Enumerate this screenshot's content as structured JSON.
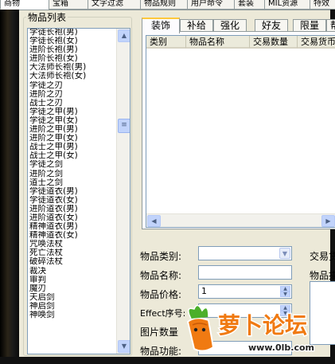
{
  "top_tabs": [
    {
      "label": "商物"
    },
    {
      "label": "宝箱"
    },
    {
      "label": "文字过滤"
    },
    {
      "label": "物品规则"
    },
    {
      "label": "用户命令"
    },
    {
      "label": "套装"
    },
    {
      "label": "MIL资源"
    },
    {
      "label": "特效"
    }
  ],
  "item_list": {
    "title": "物品列表",
    "items": [
      "学徒长袍(男)",
      "学徒长袍(女)",
      "进阶长袍(男)",
      "进阶长袍(女)",
      "大法师长袍(男)",
      "大法师长袍(女)",
      "学徒之刃",
      "进阶之刃",
      "战士之刃",
      "学徒之甲(男)",
      "学徒之甲(女)",
      "进阶之甲(男)",
      "进阶之甲(女)",
      "战士之甲(男)",
      "战士之甲(女)",
      "学徒之剑",
      "进阶之剑",
      "道士之剑",
      "学徒道衣(男)",
      "学徒道衣(女)",
      "进阶道衣(男)",
      "进阶道衣(女)",
      "精神道衣(男)",
      "精神道衣(女)",
      "咒唤法杖",
      "死亡法杖",
      "破碎法杖",
      "裁决",
      "审判",
      "魔刃",
      "天启剑",
      "神启剑",
      "神唤剑"
    ]
  },
  "right_tabs": [
    {
      "label": "装饰"
    },
    {
      "label": "补给"
    },
    {
      "label": "强化"
    },
    {
      "label": "好友"
    },
    {
      "label": "限量"
    },
    {
      "label": "帮"
    }
  ],
  "table": {
    "columns": [
      "类别",
      "物品名称",
      "交易数量",
      "交易货币"
    ]
  },
  "form": {
    "category_label": "物品类别:",
    "category_value": "",
    "name_label": "物品名称:",
    "name_value": "",
    "price_label": "物品价格:",
    "price_value": "1",
    "effect_label": "Effect序号:",
    "picture_label": "图片数量",
    "function_label": "物品功能:",
    "trade_label": "交易货",
    "item_desc_label": "物品描"
  },
  "watermark": {
    "brand": "萝卜论坛",
    "url": "www.0lb.com"
  },
  "colors": {
    "accent_tab": "#ffc83c",
    "window_bg": "#ece9d8",
    "field_border": "#7f9db9",
    "logo_orange": "#f07a12",
    "logo_green": "#4caf2a"
  },
  "icons": [
    "scroll-up-arrow",
    "scroll-down-arrow",
    "scroll-thumb-grip",
    "scroll-left-arrow",
    "scroll-right-arrow",
    "combo-down-arrow",
    "spin-up-arrow",
    "spin-down-arrow",
    "carrot-mascot"
  ]
}
